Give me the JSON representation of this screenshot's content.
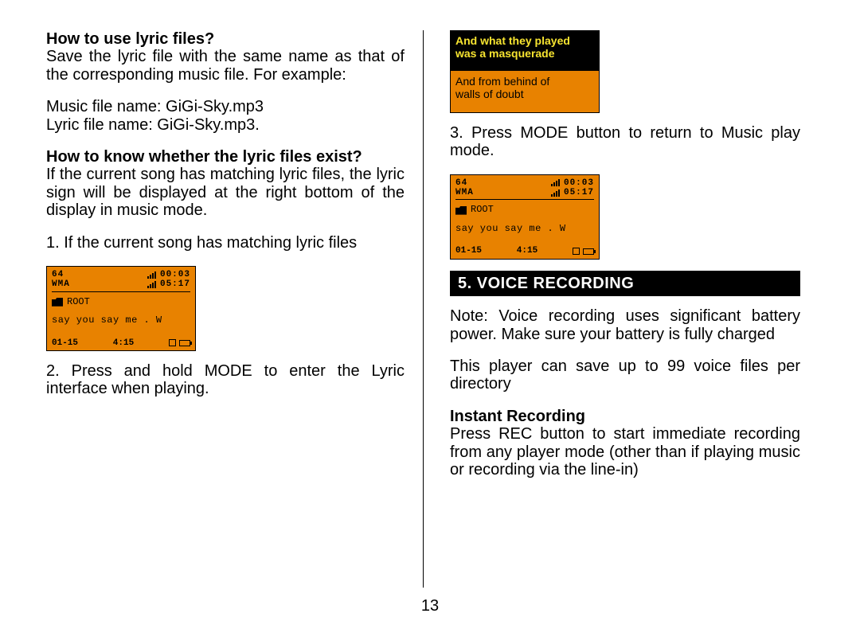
{
  "page_number": "13",
  "left": {
    "h1": "How to use lyric files?",
    "p1": "Save the lyric file with the same name as that of the corresponding music file. For example:",
    "p2a": "Music file name: GiGi-Sky.mp3",
    "p2b": "Lyric file name: GiGi-Sky.mp3.",
    "h2": "How to know whether the lyric files exist?",
    "p3": "If the current song has matching lyric files, the lyric sign  will be displayed at the right bottom of the display in music mode.",
    "p4": "1. If the current song has matching lyric files",
    "p5": "2. Press and hold MODE to enter the Lyric interface when playing."
  },
  "right": {
    "p1": "3. Press MODE button to return to Music play mode.",
    "section": "5. VOICE RECORDING",
    "note": "Note: Voice recording uses significant battery power.  Make sure your battery is fully charged",
    "p2": "This player can save up to 99 voice files per directory",
    "h3": "Instant Recording",
    "p3": "Press REC button to start immediate recording from any player mode (other than if playing music or recording via the line-in)"
  },
  "player": {
    "top_left_1": "64",
    "top_right_1": "00:03",
    "top_left_2": "WMA",
    "top_right_2": "05:17",
    "folder": "ROOT",
    "title": "say you say me . W",
    "bottom_left": "01-15",
    "bottom_mid": "4:15"
  },
  "lyric": {
    "line1": "And what they played",
    "line2": "was a masquerade",
    "line3": "And from behind of",
    "line4": "walls of doubt"
  }
}
